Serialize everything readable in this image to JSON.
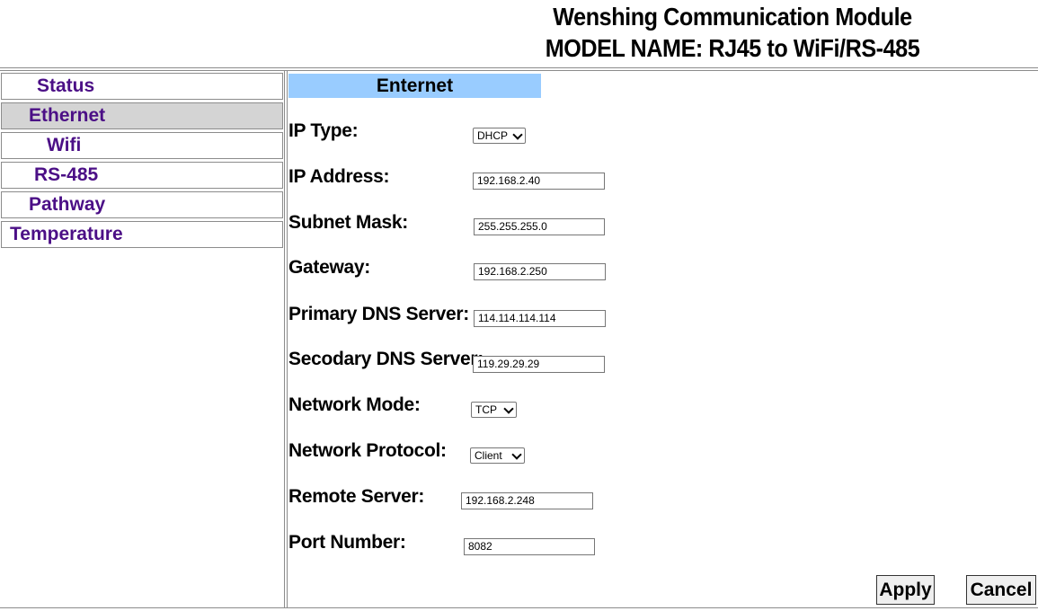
{
  "header": {
    "title_line1": "Wenshing Communication Module",
    "title_line2": "MODEL NAME: RJ45 to WiFi/RS-485"
  },
  "sidebar": {
    "items": [
      {
        "label": "Status",
        "active": false
      },
      {
        "label": "Ethernet",
        "active": true
      },
      {
        "label": "Wifi",
        "active": false
      },
      {
        "label": "RS-485",
        "active": false
      },
      {
        "label": "Pathway",
        "active": false
      },
      {
        "label": "Temperature",
        "active": false
      }
    ]
  },
  "main": {
    "section_title": "Enternet",
    "fields": {
      "ip_type": {
        "label": "IP Type:",
        "value": "DHCP"
      },
      "ip_address": {
        "label": "IP Address:",
        "value": "192.168.2.40"
      },
      "subnet_mask": {
        "label": "Subnet Mask:",
        "value": "255.255.255.0"
      },
      "gateway": {
        "label": "Gateway:",
        "value": "192.168.2.250"
      },
      "primary_dns": {
        "label": "Primary DNS Server:",
        "value": "114.114.114.114"
      },
      "secondary_dns": {
        "label": "Secodary DNS Server:",
        "value": "119.29.29.29"
      },
      "network_mode": {
        "label": "Network Mode:",
        "value": "TCP"
      },
      "network_protocol": {
        "label": "Network Protocol:",
        "value": "Client"
      },
      "remote_server": {
        "label": "Remote Server:",
        "value": "192.168.2.248"
      },
      "port_number": {
        "label": "Port Number:",
        "value": "8082"
      }
    },
    "buttons": {
      "apply": "Apply",
      "cancel": "Cancel"
    }
  },
  "colors": {
    "nav_text": "#4b0f86",
    "nav_active_bg": "#d4d4d4",
    "section_header_bg": "#99ccff",
    "border": "#8c8c8c"
  },
  "icons": {
    "select_arrow": "chevron-down-icon"
  }
}
